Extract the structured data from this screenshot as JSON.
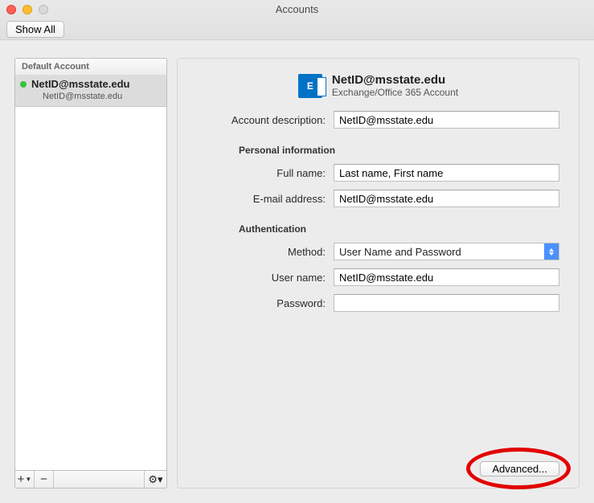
{
  "window": {
    "title": "Accounts",
    "show_all": "Show All"
  },
  "sidebar": {
    "header": "Default Account",
    "item": {
      "name": "NetID@msstate.edu",
      "sub": "NetID@msstate.edu"
    },
    "add": "+",
    "remove": "−",
    "gear": "⚙︎▾"
  },
  "header": {
    "icon_label": "E",
    "title": "NetID@msstate.edu",
    "subtitle": "Exchange/Office 365 Account"
  },
  "labels": {
    "account_desc": "Account description:",
    "personal_info": "Personal information",
    "full_name": "Full name:",
    "email": "E-mail address:",
    "authentication": "Authentication",
    "method": "Method:",
    "user_name": "User name:",
    "password": "Password:",
    "advanced": "Advanced..."
  },
  "values": {
    "account_desc": "NetID@msstate.edu",
    "full_name": "Last name, First name",
    "email": "NetID@msstate.edu",
    "method": "User Name and Password",
    "user_name": "NetID@msstate.edu",
    "password": ""
  }
}
